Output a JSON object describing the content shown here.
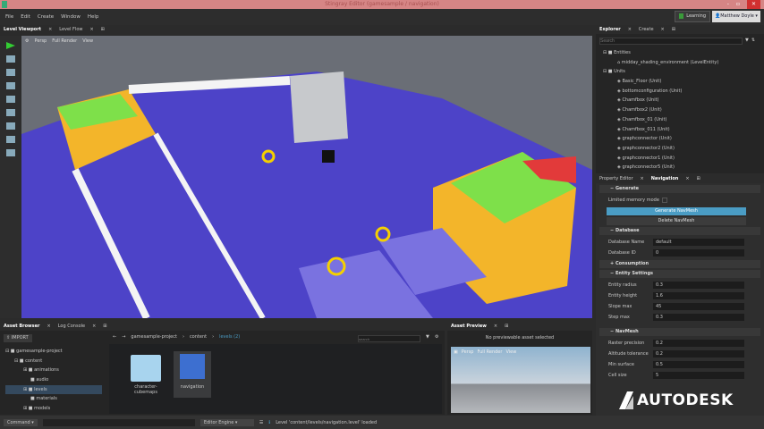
{
  "window": {
    "title": "Stingray Editor (gamesample / navigation)",
    "min": "-",
    "max": "▫",
    "close": "✕"
  },
  "menu": [
    "File",
    "Edit",
    "Create",
    "Window",
    "Help"
  ],
  "header": {
    "learning": "Learning",
    "user": "Matthew Doyle"
  },
  "viewport_tabs": [
    "Level Viewport",
    "Level Flow"
  ],
  "viewport_toolbar": {
    "persp": "Persp",
    "render": "Full Render",
    "view": "View"
  },
  "explorer": {
    "tabs": [
      "Explorer",
      "Create"
    ],
    "search_placeholder": "Search",
    "groups": [
      {
        "label": "Entities",
        "items": [
          "midday_shading_environment (LevelEntity)"
        ]
      },
      {
        "label": "Units",
        "items": [
          "Basic_Floor (Unit)",
          "bottomconfiguration (Unit)",
          "Chamfbox (Unit)",
          "Chamfbox2 (Unit)",
          "Chamfbox_01 (Unit)",
          "Chamfbox_011 (Unit)",
          "graphconnector (Unit)",
          "graphconnector2 (Unit)",
          "graphconnector1 (Unit)",
          "graphconnector5 (Unit)"
        ]
      }
    ]
  },
  "property_tabs": [
    "Property Editor",
    "Navigation"
  ],
  "navigation": {
    "generate": {
      "title": "Generate",
      "limited_memory": "Limited memory mode",
      "generate_btn": "Generate NavMesh",
      "delete_btn": "Delete NavMesh"
    },
    "database": {
      "title": "Database",
      "name_label": "Database Name",
      "name_value": "default",
      "id_label": "Database ID",
      "id_value": "0"
    },
    "consumption": {
      "title": "Consumption"
    },
    "entity": {
      "title": "Entity Settings",
      "rows": [
        {
          "label": "Entity radius",
          "value": "0.3"
        },
        {
          "label": "Entity height",
          "value": "1.6"
        },
        {
          "label": "Slope max",
          "value": "45"
        },
        {
          "label": "Step max",
          "value": "0.3"
        }
      ]
    },
    "navmesh": {
      "title": "NavMesh",
      "rows": [
        {
          "label": "Raster precision",
          "value": "0.2"
        },
        {
          "label": "Altitude tolerance",
          "value": "0.2"
        },
        {
          "label": "Min surface",
          "value": "0.5"
        },
        {
          "label": "Cell size",
          "value": "5"
        }
      ]
    }
  },
  "asset_browser": {
    "tabs": [
      "Asset Browser",
      "Log Console"
    ],
    "import": "IMPORT",
    "tree": [
      {
        "label": "gamesample-project",
        "depth": 0
      },
      {
        "label": "content",
        "depth": 1
      },
      {
        "label": "animations",
        "depth": 2
      },
      {
        "label": "audio",
        "depth": 2
      },
      {
        "label": "levels",
        "depth": 2,
        "selected": true
      },
      {
        "label": "materials",
        "depth": 2
      },
      {
        "label": "models",
        "depth": 2
      }
    ],
    "breadcrumb": [
      "gamesample-project",
      "content",
      "levels (2)"
    ],
    "search_placeholder": "search",
    "assets": [
      {
        "name": "character-cubemaps",
        "type": "folder"
      },
      {
        "name": "navigation",
        "type": "level"
      }
    ]
  },
  "asset_preview": {
    "tab": "Asset Preview",
    "message": "No previewable asset selected",
    "persp": "Persp",
    "render": "Full Render",
    "view": "View"
  },
  "status": {
    "command": "Command",
    "engine": "Editor Engine",
    "message": "Level 'content/levels/navigation.level' loaded"
  },
  "watermark": "AUTODESK",
  "colors": {
    "navmesh": "#4d43c8",
    "accent": "#4a9cc4",
    "titlebar": "#d68585"
  }
}
